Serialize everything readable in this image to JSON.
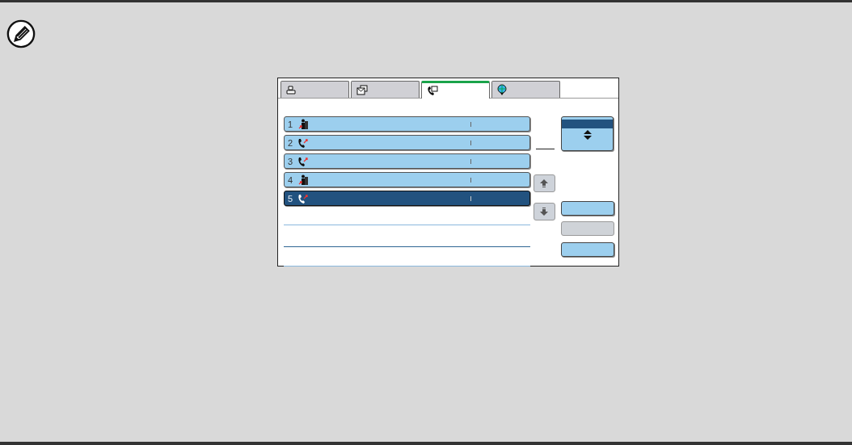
{
  "tabs": [
    {
      "kind": "printer",
      "selected": false
    },
    {
      "kind": "mail",
      "selected": false
    },
    {
      "kind": "phone",
      "selected": true
    },
    {
      "kind": "globe",
      "selected": false
    }
  ],
  "entries": [
    {
      "number": "1",
      "kind": "group",
      "selected": false
    },
    {
      "number": "2",
      "kind": "phone",
      "selected": false
    },
    {
      "number": "3",
      "kind": "phone",
      "selected": false
    },
    {
      "number": "4",
      "kind": "group",
      "selected": false
    },
    {
      "number": "5",
      "kind": "phone",
      "selected": true
    }
  ],
  "action_buttons": [
    {
      "disabled": false
    },
    {
      "disabled": true
    },
    {
      "disabled": false
    }
  ]
}
